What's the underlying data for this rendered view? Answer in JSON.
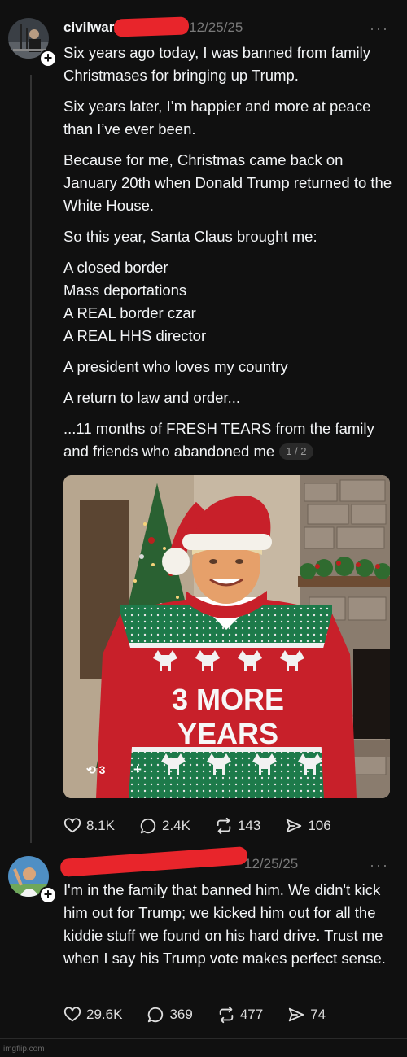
{
  "post1": {
    "handle": "civilwar.",
    "date": "12/25/25",
    "more": "···",
    "paragraphs": [
      "Six years ago today, I was banned from family Christmases for bringing up Trump.",
      "Six years later, I’m happier and more at peace than I’ve ever been.",
      "Because for me, Christmas came back on January 20th when Donald Trump returned to the White House.",
      "So this year, Santa Claus brought me:"
    ],
    "list_lines": [
      "A closed border",
      "Mass deportations",
      "A REAL border czar",
      "A REAL HHS director"
    ],
    "paragraphs2": [
      "A president who loves my country",
      "A return to law and order..."
    ],
    "last_paragraph": "...11 months of FRESH TEARS from the family and friends who abandoned me",
    "pager": "1 / 2",
    "image": {
      "sweater_line1": "3 MORE",
      "sweater_line2": "YEARS",
      "repost_count": "3",
      "plus": "+"
    },
    "actions": {
      "likes": "8.1K",
      "replies": "2.4K",
      "reposts": "143",
      "shares": "106"
    }
  },
  "post2": {
    "date": "12/25/25",
    "more": "···",
    "text": "I'm in the family that banned him. We didn't kick him out for Trump; we kicked him out for all the kiddie stuff we found on his hard drive. Trust me when I say his Trump vote makes perfect sense.",
    "actions": {
      "likes": "29.6K",
      "replies": "369",
      "reposts": "477",
      "shares": "74"
    }
  },
  "watermark": "imgflip.com",
  "colors": {
    "background": "#101010",
    "redaction": "#e8252b",
    "sweater_red": "#c8202a",
    "sweater_green": "#1d7a4a"
  }
}
